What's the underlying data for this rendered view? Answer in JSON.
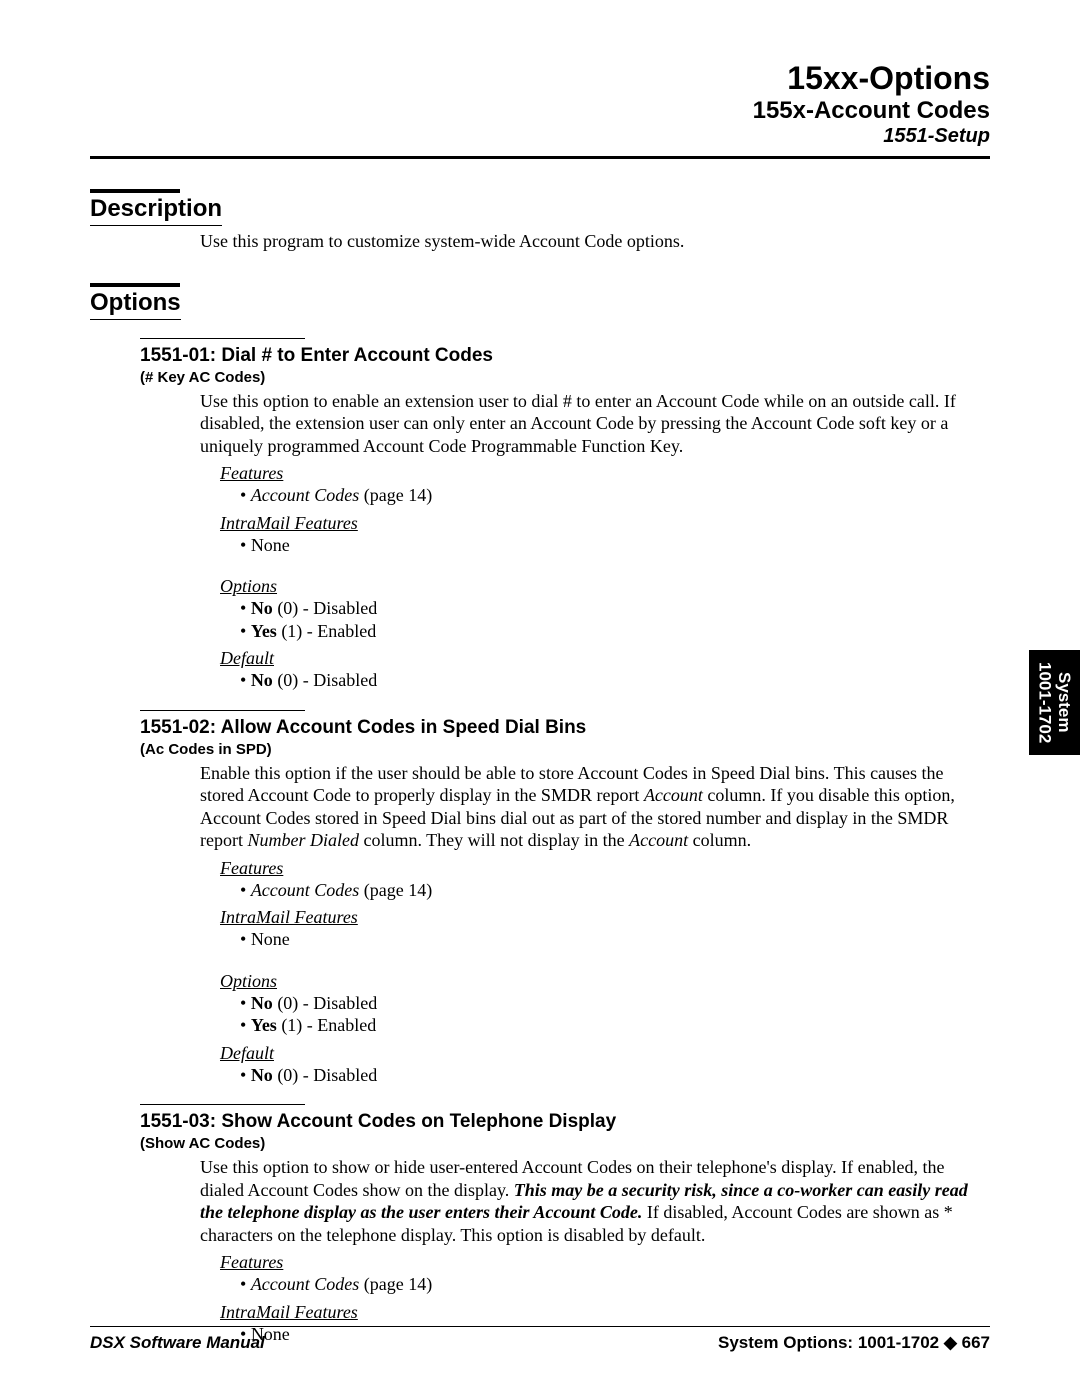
{
  "header": {
    "line1": "15xx-Options",
    "line2": "155x-Account Codes",
    "line3": "1551-Setup"
  },
  "sections": {
    "description": {
      "title": "Description",
      "text": "Use this program to customize system-wide Account Code options."
    },
    "options": {
      "title": "Options"
    }
  },
  "labels": {
    "features": "Features",
    "intramail": "IntraMail Features",
    "options": "Options",
    "default": "Default"
  },
  "opt1": {
    "head": "1551-01: Dial # to Enter Account Codes",
    "sub": "(# Key AC Codes)",
    "text": "Use this option to enable an extension user to dial # to enter an Account Code while on an outside call. If disabled, the extension user can only enter an Account Code by pressing the Account Code soft key or a uniquely programmed Account Code Programmable Function Key.",
    "feat_pre": "Account Codes",
    "feat_post": " (page 14)",
    "im": "None",
    "o1_bold": "No",
    "o1_rest": " (0) - Disabled",
    "o2_bold": "Yes",
    "o2_rest": " (1) - Enabled",
    "def_bold": "No",
    "def_rest": " (0) - Disabled"
  },
  "opt2": {
    "head": "1551-02: Allow Account Codes in Speed Dial Bins",
    "sub": "(Ac Codes in SPD)",
    "t1": "Enable this option if the user should be able to store Account Codes in Speed Dial bins. This causes the stored Account Code to properly display in the SMDR report ",
    "t2": "Account",
    "t3": " column. If you disable this option, Account Codes stored in Speed Dial bins dial out as part of the stored number and display in the SMDR report ",
    "t4": "Number Dialed",
    "t5": " column. They will not display in the ",
    "t6": "Account",
    "t7": " column.",
    "feat_pre": "Account Codes",
    "feat_post": " (page 14)",
    "im": "None",
    "o1_bold": "No",
    "o1_rest": " (0) - Disabled",
    "o2_bold": "Yes",
    "o2_rest": " (1) - Enabled",
    "def_bold": "No",
    "def_rest": " (0) - Disabled"
  },
  "opt3": {
    "head": "1551-03: Show Account Codes on Telephone Display",
    "sub": "(Show AC Codes)",
    "t1": "Use this option to show or hide user-entered Account Codes on their telephone's display. If enabled, the dialed Account Codes show on the display. ",
    "t2": "This may be a security risk, since a co-worker can easily read the telephone display as the user enters their Account Code.",
    "t3": " If disabled, Account Codes are shown as * characters on the telephone display. This option is disabled by default.",
    "feat_pre": "Account Codes",
    "feat_post": " (page 14)",
    "im": "None"
  },
  "side": {
    "line1": "System",
    "line2": "1001-1702"
  },
  "footer": {
    "left": "DSX Software Manual",
    "right": "System Options: 1001-1702   ◆   667"
  }
}
